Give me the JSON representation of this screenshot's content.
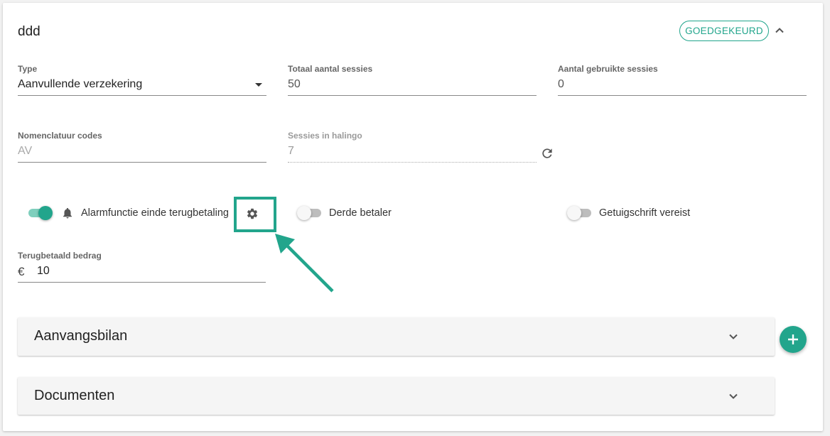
{
  "header": {
    "title": "ddd",
    "status": "GOEDGEKEURD"
  },
  "fields": {
    "type": {
      "label": "Type",
      "value": "Aanvullende verzekering"
    },
    "total_sessions": {
      "label": "Totaal aantal sessies",
      "value": "50"
    },
    "used_sessions": {
      "label": "Aantal gebruikte sessies",
      "value": "0"
    },
    "nomenclature": {
      "label": "Nomenclatuur codes",
      "value": "AV"
    },
    "sessions_halingo": {
      "label": "Sessies in halingo",
      "value": "7"
    },
    "refund_amount": {
      "label": "Terugbetaald bedrag",
      "currency": "€",
      "value": "10"
    }
  },
  "toggles": {
    "alarm": {
      "label": "Alarmfunctie einde terugbetaling",
      "on": true
    },
    "third_party": {
      "label": "Derde betaler",
      "on": false
    },
    "certificate": {
      "label": "Getuigschrift vereist",
      "on": false
    }
  },
  "panels": [
    {
      "title": "Aanvangsbilan"
    },
    {
      "title": "Documenten"
    }
  ],
  "colors": {
    "accent": "#22a58c",
    "annotation": "#22a58c"
  },
  "icons": {
    "chevron_up": "chevron-up-icon",
    "bell": "bell-icon",
    "settings": "gear-icon",
    "refresh": "refresh-icon",
    "add": "plus-icon",
    "chevron_down": "chevron-down-icon"
  }
}
